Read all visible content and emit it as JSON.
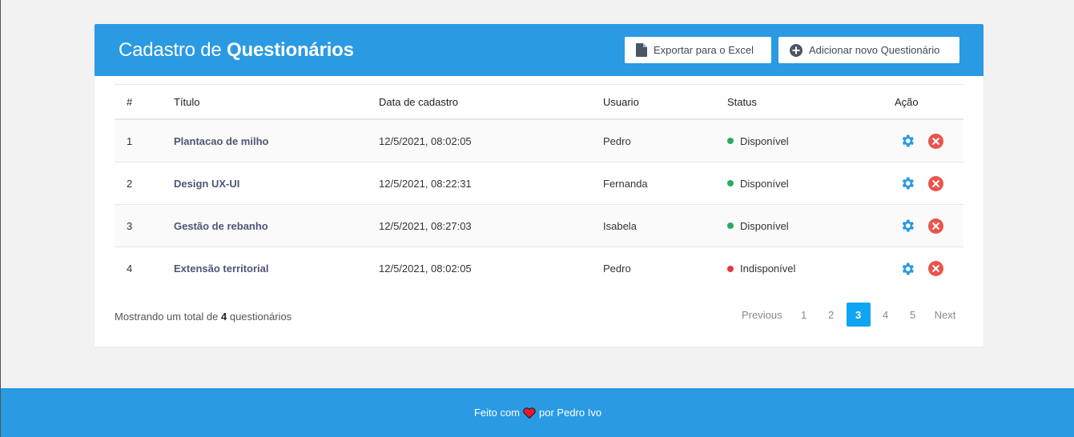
{
  "header": {
    "title_prefix": "Cadastro de",
    "title_bold": "Questionários",
    "export_label": "Exportar para o Excel",
    "add_label": "Adicionar novo Questionário"
  },
  "table": {
    "columns": [
      "#",
      "Título",
      "Data de cadastro",
      "Usuario",
      "Status",
      "Ação"
    ],
    "rows": [
      {
        "num": "1",
        "title": "Plantacao de milho",
        "date": "12/5/2021, 08:02:05",
        "user": "Pedro",
        "status": "Disponível",
        "status_color": "#27ae60"
      },
      {
        "num": "2",
        "title": "Design UX-UI",
        "date": "12/5/2021, 08:22:31",
        "user": "Fernanda",
        "status": "Disponível",
        "status_color": "#27ae60"
      },
      {
        "num": "3",
        "title": "Gestão de rebanho",
        "date": "12/5/2021, 08:27:03",
        "user": "Isabela",
        "status": "Disponível",
        "status_color": "#27ae60"
      },
      {
        "num": "4",
        "title": "Extensão territorial",
        "date": "12/5/2021, 08:02:05",
        "user": "Pedro",
        "status": "Indisponível",
        "status_color": "#e53945"
      }
    ]
  },
  "summary": {
    "prefix": "Mostrando um total de",
    "count": "4",
    "suffix": "questionários"
  },
  "pagination": {
    "previous": "Previous",
    "pages": [
      "1",
      "2",
      "3",
      "4",
      "5"
    ],
    "active": "3",
    "next": "Next"
  },
  "footer": {
    "made_with": "Feito com",
    "by": "por Pedro Ivo"
  },
  "colors": {
    "primary": "#2a9ae3",
    "active_page": "#0ea5f2",
    "gear": "#2a9ae3",
    "delete": "#e8554d"
  },
  "icons": {
    "export": "document-icon",
    "add": "plus-circle-icon",
    "edit": "gear-icon",
    "delete": "close-circle-icon",
    "footer": "heart-icon"
  }
}
